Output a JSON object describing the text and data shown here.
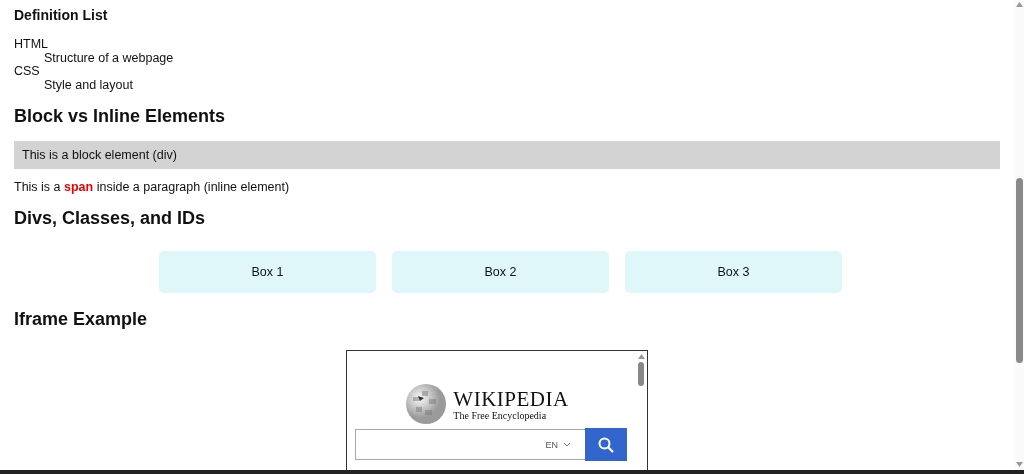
{
  "definition_list": {
    "heading": "Definition List",
    "items": [
      {
        "term": "HTML",
        "description": "Structure of a webpage"
      },
      {
        "term": "CSS",
        "description": "Style and layout"
      }
    ]
  },
  "block_inline": {
    "heading": "Block vs Inline Elements",
    "block_text": "This is a block element (div)",
    "inline_text": "This is a **span** inside a paragraph (inline element)"
  },
  "divs": {
    "heading": "Divs, Classes, and IDs",
    "boxes": [
      "Box 1",
      "Box 2",
      "Box 3"
    ]
  },
  "iframe": {
    "heading": "Iframe Example",
    "wordmark": "WIKIPEDIA",
    "tagline": "The Free Encyclopedia",
    "language": "EN"
  }
}
